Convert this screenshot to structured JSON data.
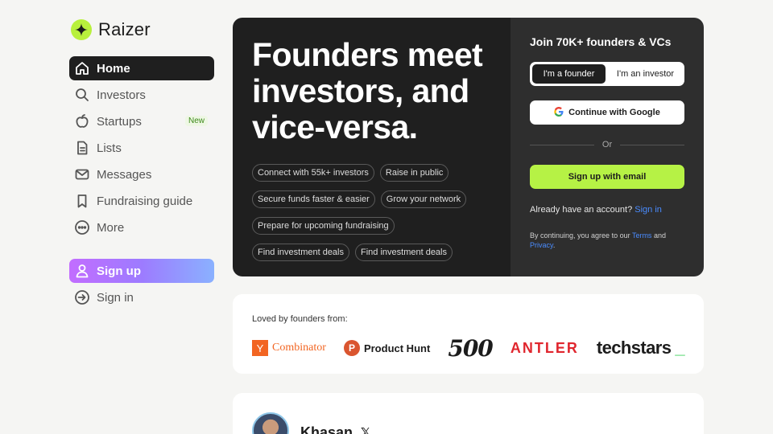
{
  "app": {
    "name": "Raizer"
  },
  "sidebar": {
    "items": [
      {
        "label": "Home",
        "icon": "home-icon",
        "active": true
      },
      {
        "label": "Investors",
        "icon": "search-icon"
      },
      {
        "label": "Startups",
        "icon": "apple-icon",
        "badge": "New"
      },
      {
        "label": "Lists",
        "icon": "document-icon"
      },
      {
        "label": "Messages",
        "icon": "mail-icon"
      },
      {
        "label": "Fundraising guide",
        "icon": "bookmark-icon"
      },
      {
        "label": "More",
        "icon": "more-icon"
      }
    ],
    "signup_label": "Sign up",
    "signin_label": "Sign in"
  },
  "hero": {
    "title": "Founders meet investors, and vice-versa.",
    "pills": [
      [
        "Connect with 55k+ investors",
        "Raise in public"
      ],
      [
        "Secure funds faster & easier",
        "Grow your network"
      ],
      [
        "Prepare for upcoming fundraising"
      ],
      [
        "Find investment deals",
        "Find investment deals"
      ]
    ]
  },
  "signup_panel": {
    "title": "Join 70K+ founders & VCs",
    "toggle": {
      "founder": "I'm a founder",
      "investor": "I'm an investor",
      "selected": "founder"
    },
    "google_label": "Continue with Google",
    "or_label": "Or",
    "email_label": "Sign up with email",
    "already_text": "Already have an account?",
    "signin_link": "Sign in",
    "terms_prefix": "By continuing, you agree to our",
    "terms_link": "Terms",
    "terms_and": "and",
    "privacy_link": "Privacy",
    "terms_suffix": "."
  },
  "loved": {
    "title": "Loved by founders from:",
    "logos": {
      "yc_letter": "Y",
      "yc_text": "Combinator",
      "ph_letter": "P",
      "ph_text": "Product Hunt",
      "five": "500",
      "antler": "ANTLER",
      "techstars": "techstars",
      "techstars_mark": "_"
    }
  },
  "testimonial": {
    "name": "Khasan",
    "x_label": "𝕏"
  },
  "colors": {
    "accent_green": "#b6f245",
    "dark": "#1f1f1f",
    "link": "#4a8cff",
    "antler_red": "#e0262e",
    "yc_orange": "#f26522"
  }
}
